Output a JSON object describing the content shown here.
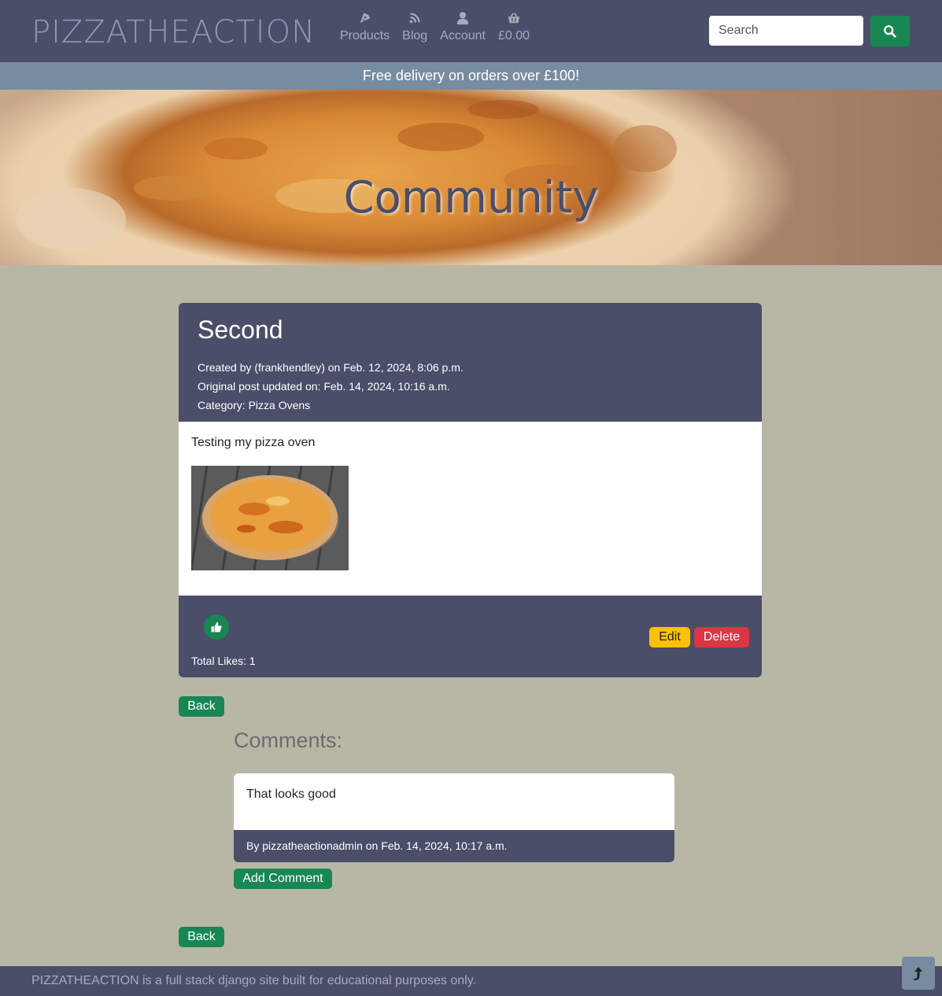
{
  "navbar": {
    "brand": "PIZZATHEACTION",
    "items": [
      {
        "label": "Products",
        "icon": "pizza-slice-icon"
      },
      {
        "label": "Blog",
        "icon": "blog-icon"
      },
      {
        "label": "Account",
        "icon": "user-icon"
      },
      {
        "label": "£0.00",
        "icon": "basket-icon"
      }
    ],
    "search_placeholder": "Search"
  },
  "banner": "Free delivery on orders over £100!",
  "hero": {
    "title": "Community"
  },
  "post": {
    "title": "Second",
    "created": "Created by (frankhendley) on Feb. 12, 2024, 8:06 p.m.",
    "updated": "Original post updated on: Feb. 14, 2024, 10:16 a.m.",
    "category": "Category: Pizza Ovens",
    "body": "Testing my pizza oven",
    "total_likes": "Total Likes: 1",
    "edit_label": "Edit",
    "delete_label": "Delete"
  },
  "back_label": "Back",
  "comments": {
    "heading": "Comments:",
    "items": [
      {
        "text": "That looks good",
        "byline": "By pizzatheactionadmin on Feb. 14, 2024, 10:17 a.m."
      }
    ],
    "add_label": "Add Comment"
  },
  "footer": {
    "text": "PIZZATHEACTION is a full stack django site built for educational purposes only."
  },
  "colors": {
    "primary": "#4b4e69",
    "page_bg": "#b8b7a6",
    "green": "#198754",
    "warning": "#ffc107",
    "danger": "#dc3545",
    "banner": "#778ca0"
  }
}
